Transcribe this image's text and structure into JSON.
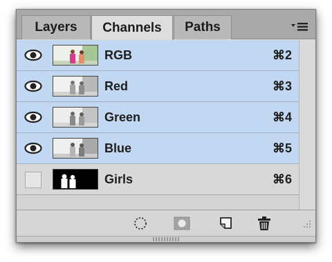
{
  "tabs": [
    {
      "label": "Layers"
    },
    {
      "label": "Channels"
    },
    {
      "label": "Paths"
    }
  ],
  "active_tab": "Channels",
  "channels": [
    {
      "name": "RGB",
      "shortcut": "⌘2",
      "visible": true,
      "selected": true
    },
    {
      "name": "Red",
      "shortcut": "⌘3",
      "visible": true,
      "selected": true
    },
    {
      "name": "Green",
      "shortcut": "⌘4",
      "visible": true,
      "selected": true
    },
    {
      "name": "Blue",
      "shortcut": "⌘5",
      "visible": true,
      "selected": true
    },
    {
      "name": "Girls",
      "shortcut": "⌘6",
      "visible": false,
      "selected": false
    }
  ],
  "footer_buttons": [
    {
      "icon": "load-channel-as-selection-icon"
    },
    {
      "icon": "save-selection-as-channel-icon"
    },
    {
      "icon": "new-channel-icon"
    },
    {
      "icon": "delete-channel-icon"
    }
  ],
  "colors": {
    "selected_row": "#c2d7f1",
    "panel_bg": "#d9d9d9",
    "tabbar_bg": "#a9a9a9"
  }
}
